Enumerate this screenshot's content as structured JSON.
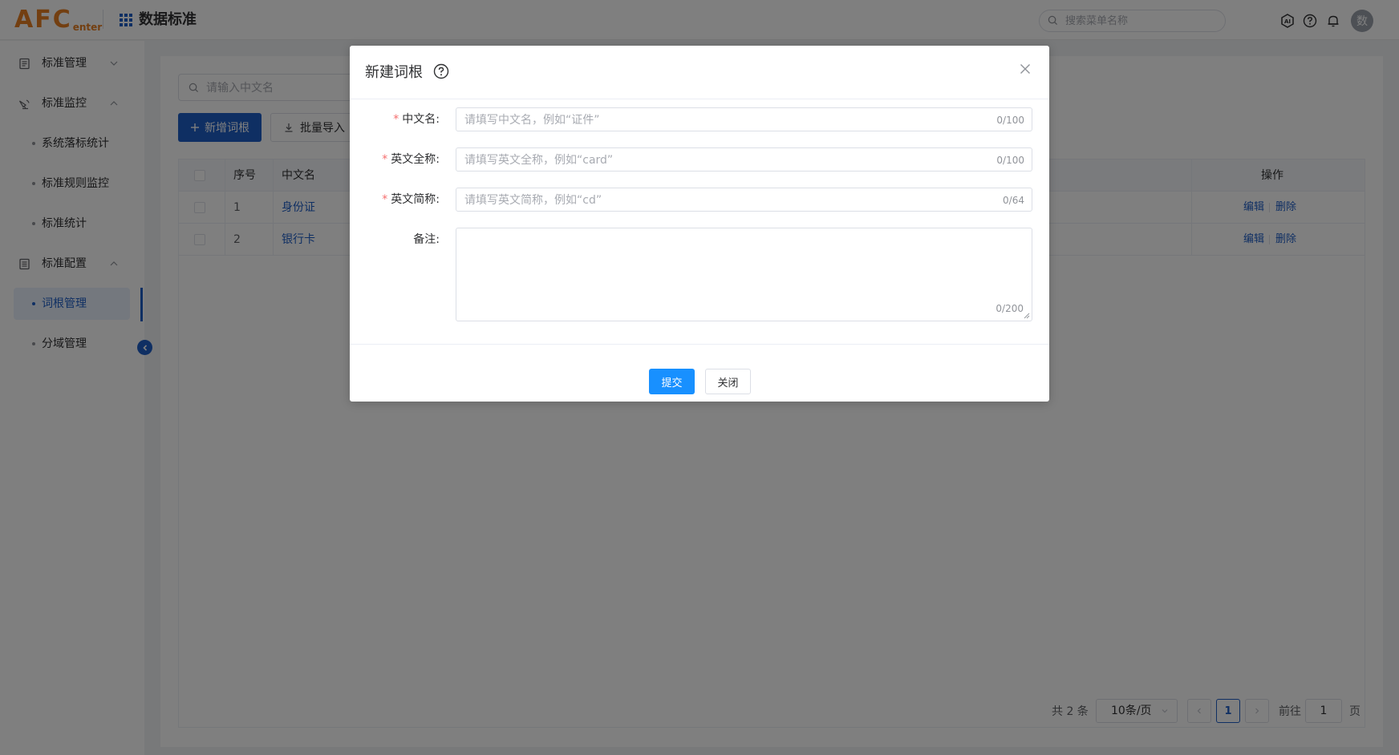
{
  "header": {
    "logo_main": "AFC",
    "logo_sub": "enter",
    "app_title": "数据标准",
    "search_placeholder": "搜索菜单名称",
    "avatar_text": "数",
    "icons": [
      "ai-icon",
      "help-icon",
      "bell-icon"
    ]
  },
  "sidebar": {
    "items": [
      {
        "label": "标准管理",
        "icon": "document-icon",
        "expanded": false
      },
      {
        "label": "标准监控",
        "icon": "monitor-icon",
        "expanded": true
      },
      {
        "label": "系统落标统计"
      },
      {
        "label": "标准规则监控"
      },
      {
        "label": "标准统计"
      },
      {
        "label": "标准配置",
        "icon": "config-icon",
        "expanded": true
      },
      {
        "label": "词根管理",
        "active": true
      },
      {
        "label": "分域管理"
      }
    ]
  },
  "main": {
    "filter_placeholder": "请输入中文名",
    "add_button": "新增词根",
    "import_button": "批量导入",
    "table": {
      "headers": [
        "序号",
        "中文名",
        "操作"
      ],
      "rows": [
        {
          "index": "1",
          "name": "身份证",
          "edit": "编辑",
          "delete": "删除"
        },
        {
          "index": "2",
          "name": "银行卡",
          "edit": "编辑",
          "delete": "删除"
        }
      ]
    },
    "pagination": {
      "total": "共 2 条",
      "page_size": "10条/页",
      "current": "1",
      "goto_label": "前往",
      "goto_value": "1",
      "page_suffix": "页"
    }
  },
  "dialog": {
    "title": "新建词根",
    "fields": [
      {
        "label": "中文名:",
        "required": true,
        "placeholder": "请填写中文名，例如“证件”",
        "count": "0/100"
      },
      {
        "label": "英文全称:",
        "required": true,
        "placeholder": "请填写英文全称，例如“card”",
        "count": "0/100"
      },
      {
        "label": "英文简称:",
        "required": true,
        "placeholder": "请填写英文简称，例如“cd”",
        "count": "0/64"
      },
      {
        "label": "备注:",
        "required": false,
        "placeholder": "",
        "count": "0/200"
      }
    ],
    "submit_label": "提交",
    "close_label": "关闭"
  },
  "colors": {
    "primary": "#1f5ec7",
    "submit": "#1890ff",
    "required": "#f56c6c",
    "logo": "#e67e22"
  }
}
